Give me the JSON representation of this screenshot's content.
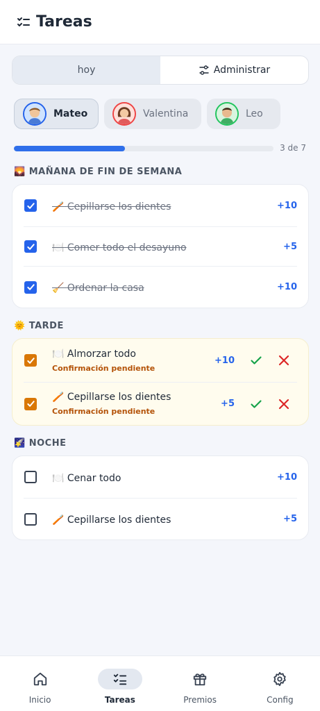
{
  "header": {
    "title": "Tareas"
  },
  "segmented": {
    "today_label": "hoy",
    "manage_label": "Administrar"
  },
  "kids": [
    {
      "name": "Mateo",
      "active": true
    },
    {
      "name": "Valentina",
      "active": false
    },
    {
      "name": "Leo",
      "active": false
    }
  ],
  "progress": {
    "label": "3 de 7",
    "completed": 3,
    "total": 7
  },
  "sections": [
    {
      "label": "MAÑANA DE FIN DE SEMANA",
      "icon": "🌄",
      "tasks": [
        {
          "icon": "🪥",
          "name": "Cepillarse los dientes",
          "points": "+10",
          "state": "done"
        },
        {
          "icon": "🍽️",
          "name": "Comer todo el desayuno",
          "points": "+5",
          "state": "done"
        },
        {
          "icon": "🧹",
          "name": "Ordenar la casa",
          "points": "+10",
          "state": "done"
        }
      ]
    },
    {
      "label": "TARDE",
      "icon": "🌞",
      "tasks": [
        {
          "icon": "🍽️",
          "name": "Almorzar todo",
          "status": "Confirmación pendiente",
          "points": "+10",
          "state": "pending"
        },
        {
          "icon": "🪥",
          "name": "Cepillarse los dientes",
          "status": "Confirmación pendiente",
          "points": "+5",
          "state": "pending"
        }
      ]
    },
    {
      "label": "NOCHE",
      "icon": "🌠",
      "tasks": [
        {
          "icon": "🍽️",
          "name": "Cenar todo",
          "points": "+10",
          "state": "todo"
        },
        {
          "icon": "🪥",
          "name": "Cepillarse los dientes",
          "points": "+5",
          "state": "todo"
        }
      ]
    }
  ],
  "nav": [
    {
      "label": "Inicio",
      "icon": "home-icon"
    },
    {
      "label": "Tareas",
      "icon": "checklist-icon",
      "active": true
    },
    {
      "label": "Premios",
      "icon": "gift-icon"
    },
    {
      "label": "Config",
      "icon": "gear-icon"
    }
  ],
  "colors": {
    "accent": "#2563eb",
    "pending": "#d97706",
    "approve": "#16a34a",
    "reject": "#dc2626"
  }
}
